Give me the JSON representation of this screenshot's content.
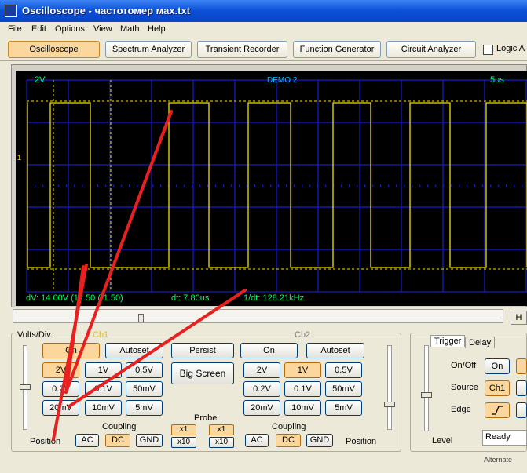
{
  "window": {
    "title": "Oscilloscope - частотомер мах.txt",
    "icon": "oscilloscope-app-icon"
  },
  "menu": [
    "File",
    "Edit",
    "Options",
    "View",
    "Math",
    "Help"
  ],
  "tabs": [
    {
      "label": "Oscilloscope",
      "active": true
    },
    {
      "label": "Spectrum Analyzer",
      "active": false
    },
    {
      "label": "Transient Recorder",
      "active": false
    },
    {
      "label": "Function Generator",
      "active": false
    },
    {
      "label": "Circuit Analyzer",
      "active": false
    }
  ],
  "logic_checkbox": {
    "label": "Logic A",
    "checked": false
  },
  "scope": {
    "volts_label": "2V",
    "mode_label": "DEMO 2",
    "time_label": "5us",
    "ch_marker": "1",
    "readout_dv": "dV: 14.00V (12.50 (-1.50)",
    "readout_dt": "dt: 7.80us",
    "readout_freq": "1/dt: 128.21kHz",
    "colors": {
      "grid": "#1a1ad0",
      "trace": "#f0e000",
      "cursor": "#f0e000",
      "readout": "#00ff66",
      "header": "#00ff66"
    }
  },
  "hslider": {
    "button_label": "H"
  },
  "ch1": {
    "panel_title": "Volts/Div.",
    "channel_label": "Ch1",
    "on_label": "On",
    "autoset_label": "Autoset",
    "volts_buttons": [
      "2V",
      "1V",
      "0.5V",
      "0.2V",
      "0.1V",
      "50mV",
      "20mV",
      "10mV",
      "5mV"
    ],
    "selected_volts": "2V",
    "coupling_title": "Coupling",
    "coupling": [
      "AC",
      "DC",
      "GND"
    ],
    "selected_coupling": "DC",
    "position_label": "Position"
  },
  "center": {
    "persist_label": "Persist",
    "bigscreen_label": "Big Screen",
    "probe_title": "Probe",
    "probe_ch1": [
      "x1",
      "x10"
    ],
    "probe_ch2": [
      "x1",
      "x10"
    ]
  },
  "ch2": {
    "channel_label": "Ch2",
    "on_label": "On",
    "autoset_label": "Autoset",
    "volts_buttons": [
      "2V",
      "1V",
      "0.5V",
      "0.2V",
      "0.1V",
      "50mV",
      "20mV",
      "10mV",
      "5mV"
    ],
    "selected_volts": "1V",
    "coupling_title": "Coupling",
    "coupling": [
      "AC",
      "DC",
      "GND"
    ],
    "selected_coupling": "DC",
    "position_label": "Position"
  },
  "trigger": {
    "tabs": [
      "Trigger",
      "Delay"
    ],
    "onoff_label": "On/Off",
    "on_button": "On",
    "source_label": "Source",
    "source_button": "Ch1",
    "edge_label": "Edge",
    "level_label": "Level",
    "status": "Ready"
  },
  "footer_text": "Alternate"
}
